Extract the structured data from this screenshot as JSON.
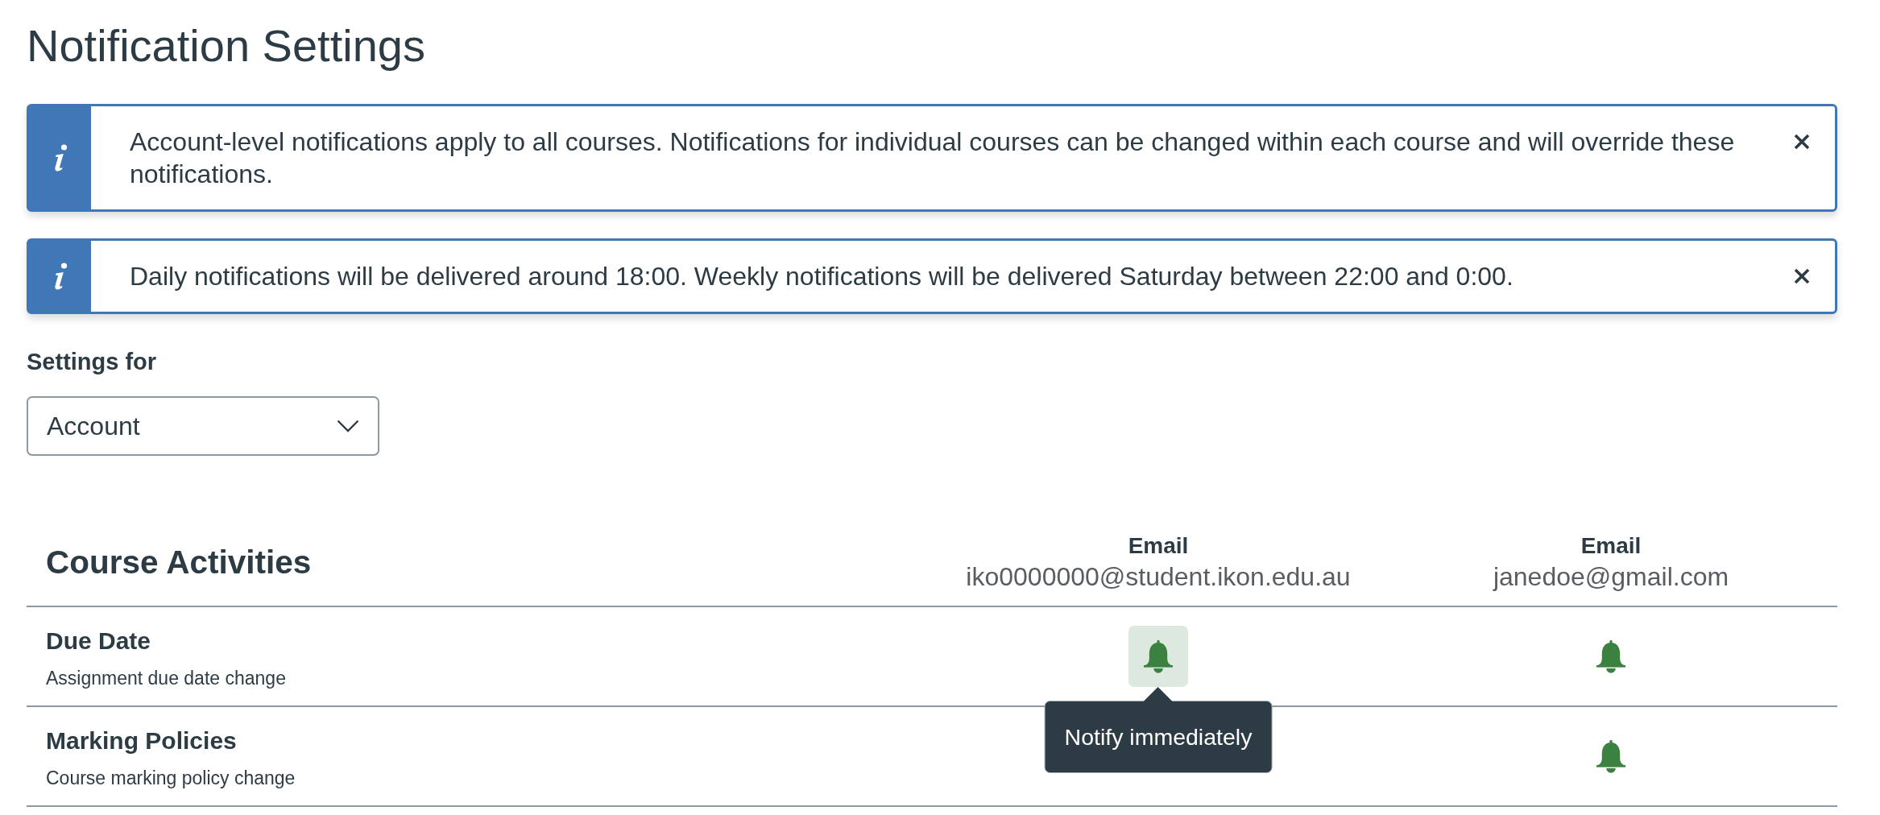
{
  "page": {
    "title": "Notification Settings"
  },
  "alerts": [
    {
      "message": "Account-level notifications apply to all courses. Notifications for individual courses can be changed within each course and will override these notifications."
    },
    {
      "message": "Daily notifications will be delivered around 18:00. Weekly notifications will be delivered Saturday between 22:00 and 0:00."
    }
  ],
  "settings_for": {
    "label": "Settings for",
    "value": "Account"
  },
  "table": {
    "title": "Course Activities",
    "columns": [
      {
        "label": "Email",
        "address": "iko0000000@student.ikon.edu.au"
      },
      {
        "label": "Email",
        "address": "janedoe@gmail.com"
      }
    ],
    "rows": [
      {
        "title": "Due Date",
        "description": "Assignment due date change",
        "cells": [
          {
            "focused": true,
            "tooltip": "Notify immediately"
          },
          {
            "focused": false
          }
        ]
      },
      {
        "title": "Marking Policies",
        "description": "Course marking policy change",
        "cells": [
          null,
          {
            "focused": false
          }
        ]
      }
    ]
  }
}
